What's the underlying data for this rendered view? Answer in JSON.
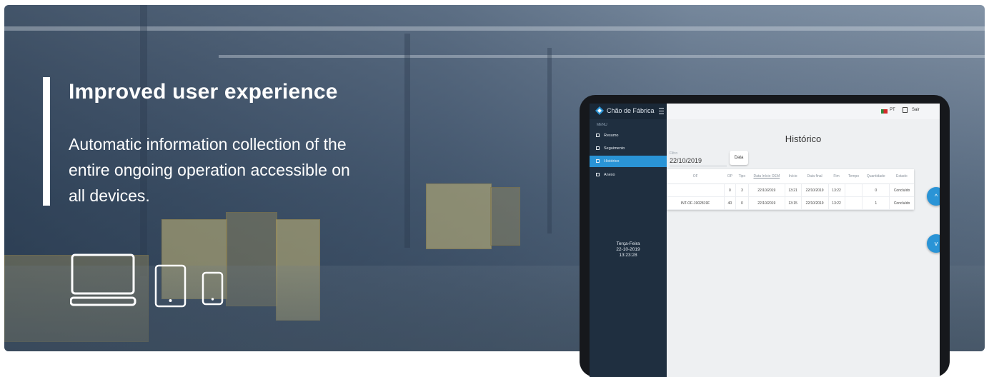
{
  "hero": {
    "headline": "Improved user experience",
    "description": "Automatic information collection of the entire ongoing operation accessible on all devices.",
    "device_icons": [
      "laptop-icon",
      "tablet-icon",
      "phone-icon"
    ]
  },
  "app": {
    "title": "Chão de Fábrica",
    "menu_caption": "MENU",
    "menu": [
      {
        "label": "Resumo",
        "active": false
      },
      {
        "label": "Seguimento",
        "active": false
      },
      {
        "label": "Histórico",
        "active": true
      },
      {
        "label": "Anexo",
        "active": false
      }
    ],
    "weekday": "Terça-Feira",
    "date": "22-10-2019",
    "time": "13:23:28",
    "language": "PT",
    "exit_label": "Sair",
    "page_title": "Histórico",
    "date_filter_caption": "Filtro",
    "date_filter_value": "22/10/2019",
    "date_button": "Data",
    "table": {
      "columns": [
        "OF",
        "OP",
        "Tipo",
        "Data Início OEM",
        "Início",
        "Data final",
        "Fim",
        "Tempo",
        "Quantidade",
        "Estado"
      ],
      "rows": [
        [
          "",
          "0",
          "3",
          "22/10/2019",
          "13:21",
          "22/10/2019",
          "13:22",
          "",
          "0",
          "Concluído"
        ],
        [
          "INT-OF-1902819F",
          "40",
          "0",
          "22/10/2019",
          "13:15",
          "22/10/2019",
          "13:22",
          "",
          "1",
          "Concluído"
        ]
      ]
    },
    "scroll_up": "^",
    "scroll_down": "v"
  },
  "colors": {
    "accent": "#2a94d6",
    "sidebar": "#1f2f40",
    "overlay": "#14263c"
  }
}
